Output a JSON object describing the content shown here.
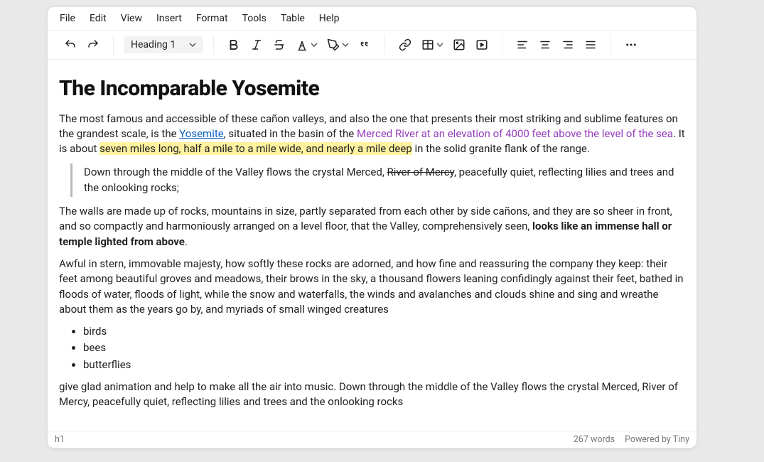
{
  "menubar": {
    "file": "File",
    "edit": "Edit",
    "view": "View",
    "insert": "Insert",
    "format": "Format",
    "tools": "Tools",
    "table": "Table",
    "help": "Help"
  },
  "toolbar": {
    "block_select": "Heading 1"
  },
  "doc": {
    "title": "The Incomparable Yosemite",
    "p1_a": "The most famous and accessible of these cañon valleys, and also the one that presents their most striking and sublime features on the grandest scale, is the ",
    "p1_link": "Yosemite",
    "p1_b": ", situated in the basin of the ",
    "p1_purple": "Merced River at an elevation of 4000 feet above the level of the sea",
    "p1_c": ". It is about ",
    "p1_hl": "seven miles long, half a mile to a mile wide, and nearly a mile deep",
    "p1_d": " in the solid granite flank of the range.",
    "bq_a": "Down through the middle of the Valley flows the crystal Merced, ",
    "bq_strike": "River of Mercy",
    "bq_b": ", peacefully quiet, reflecting lilies and trees and the onlooking rocks;",
    "p2_a": "The walls are made up of rocks, mountains in size, partly separated from each other by side cañons, and they are so sheer in front, and so compactly and harmoniously arranged on a level floor, that the Valley, comprehensively seen, ",
    "p2_bold": "looks like an immense hall or temple lighted from above",
    "p2_b": ".",
    "p3": "Awful in stern, immovable majesty, how softly these rocks are adorned, and how fine and reassuring the company they keep: their feet among beautiful groves and meadows, their brows in the sky, a thousand flowers leaning confidingly against their feet, bathed in floods of water, floods of light, while the snow and waterfalls, the winds and avalanches and clouds shine and sing and wreathe about them as the years go by, and myriads of small winged creatures",
    "list": {
      "i0": "birds",
      "i1": "bees",
      "i2": "butterflies"
    },
    "p4": "give glad animation and help to make all the air into music. Down through the middle of the Valley flows the crystal Merced, River of Mercy, peacefully quiet, reflecting lilies and trees and the onlooking rocks"
  },
  "statusbar": {
    "path": "h1",
    "wordcount": "267 words",
    "branding": "Powered by Tiny"
  }
}
